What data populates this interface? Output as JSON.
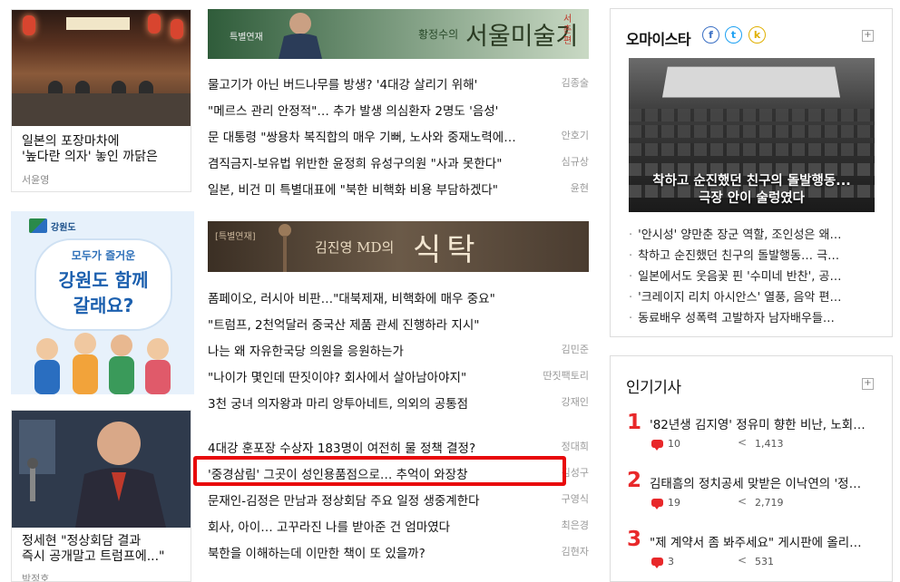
{
  "left": {
    "card1": {
      "title_line1": "일본의 포장마차에",
      "title_line2": "'높다란 의자' 놓인 까닭은",
      "author": "서윤영"
    },
    "ad": {
      "logo_text": "강원도",
      "line1": "모두가 즐거운",
      "line2": "강원도 함께",
      "line3": "갈래요?"
    },
    "card2": {
      "title_line1": "정세현 \"정상회담 결과",
      "title_line2": "즉시 공개말고 트럼프에...\"",
      "author": "박정호"
    }
  },
  "middle": {
    "banner1": {
      "tag": "특별연재",
      "author_prefix": "황정수의",
      "title": "서울미술기행",
      "stamp": "서촌편"
    },
    "group1": [
      {
        "title": "물고기가 아닌 버드나무를 방생? '4대강 살리기 위해'",
        "author": "김종술"
      },
      {
        "title": "\"메르스 관리 안정적\"… 추가 발생 의심환자 2명도 '음성'",
        "author": ""
      },
      {
        "title": "문 대통령 \"쌍용차 복직합의 매우 기뻐, 노사와 중재노력에…",
        "author": "안호기"
      },
      {
        "title": "겸직금지-보유법 위반한 윤정희 유성구의원 \"사과 못한다\"",
        "author": "심규상"
      },
      {
        "title": "일본, 비건 미 특별대표에 \"북한 비핵화 비용 부담하겠다\"",
        "author": "윤현"
      }
    ],
    "banner2": {
      "tag": "[특별연재]",
      "author_prefix": "김진영 MD의",
      "title": "식탁"
    },
    "group2": [
      {
        "title": "폼페이오, 러시아 비판…\"대북제재, 비핵화에 매우 중요\"",
        "author": ""
      },
      {
        "title": "\"트럼프, 2천억달러 중국산 제품 관세 진행하라 지시\"",
        "author": ""
      },
      {
        "title": "나는 왜 자유한국당 의원을 응원하는가",
        "author": "김민준"
      },
      {
        "title": "\"나이가 몇인데 딴짓이야? 회사에서 살아남아야지\"",
        "author": "딴짓팩토리"
      },
      {
        "title": "3천 궁녀 의자왕과 마리 앙투아네트, 의외의 공통점",
        "author": "강재인"
      }
    ],
    "group3": [
      {
        "title": "4대강 훈포장 수상자 183명이 여전히 물 정책 결정?",
        "author": "정대희"
      },
      {
        "title": "'중경삼림' 그곳이 성인용품점으로… 추억이 와장창",
        "author": "김성구"
      },
      {
        "title": "문재인-김정은 만남과 정상회담 주요 일정 생중계한다",
        "author": "구영식"
      },
      {
        "title": "회사, 아이… 고꾸라진 나를 받아준 건 엄마였다",
        "author": "최은경"
      },
      {
        "title": "북한을 이해하는데 이만한 책이 또 있을까?",
        "author": "김현자"
      }
    ]
  },
  "right": {
    "star": {
      "title": "오마이스타",
      "social": [
        "f",
        "t",
        "k"
      ],
      "caption_line1": "착하고 순진했던 친구의 돌발행동...",
      "caption_line2": "극장 안이 술렁였다",
      "items": [
        "'안시성' 양만춘 장군 역할, 조인성은 왜…",
        "착하고 순진했던 친구의 돌발행동… 극…",
        "일본에서도 웃음꽃 핀 '수미네 반찬', 공…",
        "'크레이지 리치 아시안스' 열풍, 음악 편…",
        "동료배우 성폭력 고발하자 남자배우들…"
      ]
    },
    "popular": {
      "title": "인기기사",
      "items": [
        {
          "rank": "1",
          "title": "'82년생 김지영' 정유미 향한 비난, 노회…",
          "comments": "10",
          "shares": "1,413"
        },
        {
          "rank": "2",
          "title": "김태흠의 정치공세 맞받은 이낙연의 '정…",
          "comments": "19",
          "shares": "2,719"
        },
        {
          "rank": "3",
          "title": "\"제 계약서 좀 봐주세요\" 게시판에 올리…",
          "comments": "3",
          "shares": "531"
        }
      ]
    }
  },
  "colors": {
    "accent_red": "#e8282a",
    "highlight_border": "#e8090b",
    "social_blue": "#3a6fc4"
  }
}
